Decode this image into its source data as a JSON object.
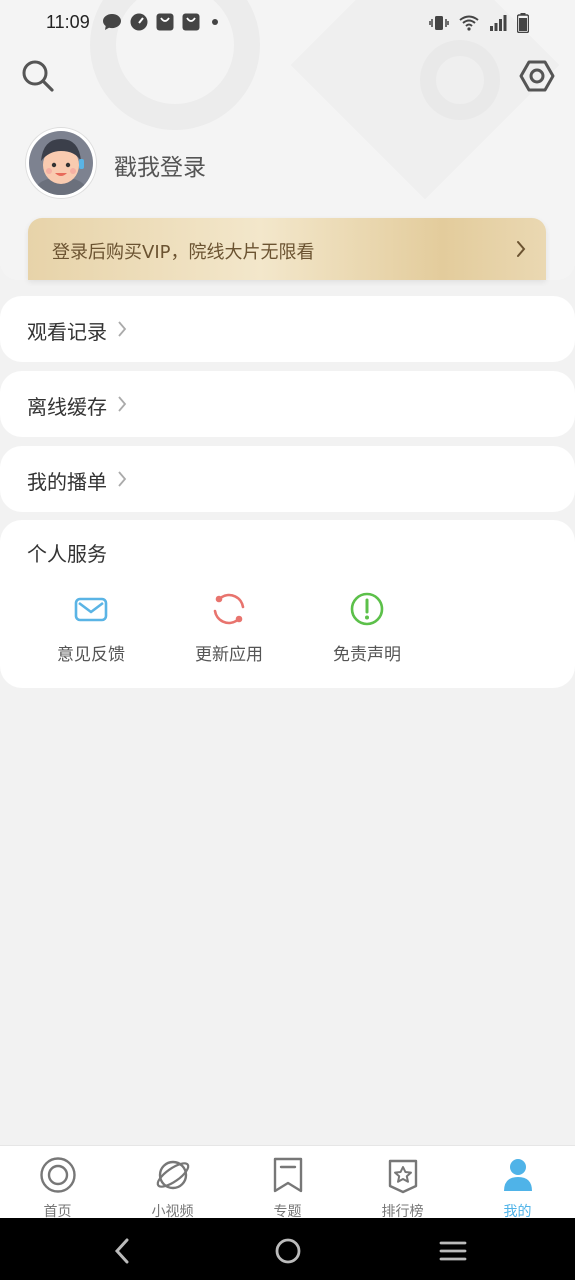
{
  "status_bar": {
    "time": "11:09",
    "notification_icons": [
      "chat-icon",
      "speedometer-icon",
      "shopping-bag-icon",
      "shopping-bag-icon",
      "dot-icon"
    ],
    "right_icons": [
      "vibrate-icon",
      "wifi-icon",
      "signal-icon",
      "battery-icon"
    ]
  },
  "header": {
    "search_icon": "search-icon",
    "settings_icon": "settings-hexagon-icon"
  },
  "profile": {
    "login_text": "戳我登录"
  },
  "vip_banner": {
    "text": "登录后购买VIP，院线大片无限看"
  },
  "menu": {
    "items": [
      {
        "label": "观看记录"
      },
      {
        "label": "离线缓存"
      },
      {
        "label": "我的播单"
      }
    ]
  },
  "services": {
    "title": "个人服务",
    "items": [
      {
        "label": "意见反馈",
        "icon": "mail-icon",
        "color": "#5ab4e5"
      },
      {
        "label": "更新应用",
        "icon": "refresh-icon",
        "color": "#e8746e"
      },
      {
        "label": "免责声明",
        "icon": "alert-circle-icon",
        "color": "#5cc04a"
      }
    ]
  },
  "tabbar": {
    "items": [
      {
        "label": "首页",
        "icon": "home-ring-icon"
      },
      {
        "label": "小视频",
        "icon": "planet-icon"
      },
      {
        "label": "专题",
        "icon": "bookmark-icon"
      },
      {
        "label": "排行榜",
        "icon": "star-badge-icon"
      },
      {
        "label": "我的",
        "icon": "person-icon",
        "active": true
      }
    ],
    "active_color": "#4fb3e8"
  },
  "system_nav": {
    "buttons": [
      "back-icon",
      "home-icon",
      "menu-icon"
    ]
  }
}
